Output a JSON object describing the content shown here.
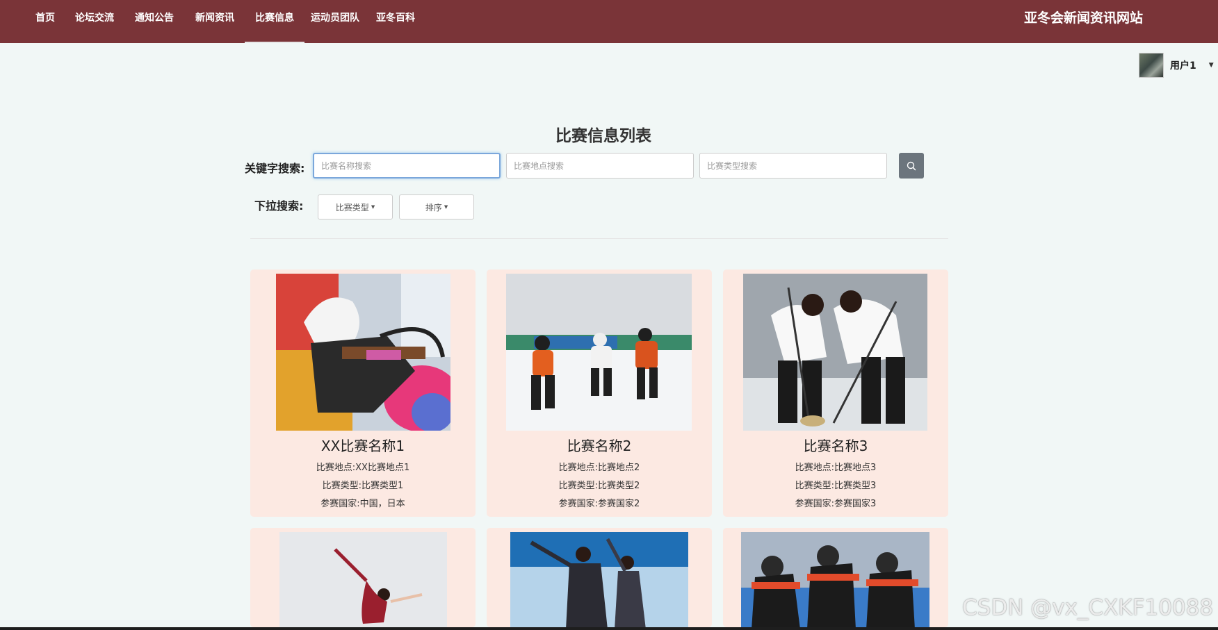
{
  "nav": {
    "items": [
      {
        "label": "首页"
      },
      {
        "label": "论坛交流"
      },
      {
        "label": "通知公告"
      },
      {
        "label": "新闻资讯"
      },
      {
        "label": "比赛信息",
        "active": true
      },
      {
        "label": "运动员团队"
      },
      {
        "label": "亚冬百科"
      }
    ],
    "site_title": "亚冬会新闻资讯网站"
  },
  "user": {
    "name": "用户1"
  },
  "page": {
    "title": "比赛信息列表"
  },
  "search": {
    "label": "关键字搜索:",
    "name_placeholder": "比赛名称搜索",
    "location_placeholder": "比赛地点搜索",
    "type_placeholder": "比赛类型搜索",
    "button_icon": "search-icon"
  },
  "dropdowns": {
    "label": "下拉搜索:",
    "type_label": "比赛类型",
    "sort_label": "排序"
  },
  "cards": [
    {
      "name": "XX比赛名称1",
      "location": "比赛地点:XX比赛地点1",
      "type": "比赛类型:比赛类型1",
      "countries": "参赛国家:中国，日本"
    },
    {
      "name": "比赛名称2",
      "location": "比赛地点:比赛地点2",
      "type": "比赛类型:比赛类型2",
      "countries": "参赛国家:参赛国家2"
    },
    {
      "name": "比赛名称3",
      "location": "比赛地点:比赛地点3",
      "type": "比赛类型:比赛类型3",
      "countries": "参赛国家:参赛国家3"
    }
  ],
  "watermark": "CSDN @vx_CXKF10088",
  "colors": {
    "nav_bg": "#7a3438",
    "card_bg": "#fce9e2",
    "search_button": "#6c757d",
    "page_bg": "#f1f7f6"
  }
}
